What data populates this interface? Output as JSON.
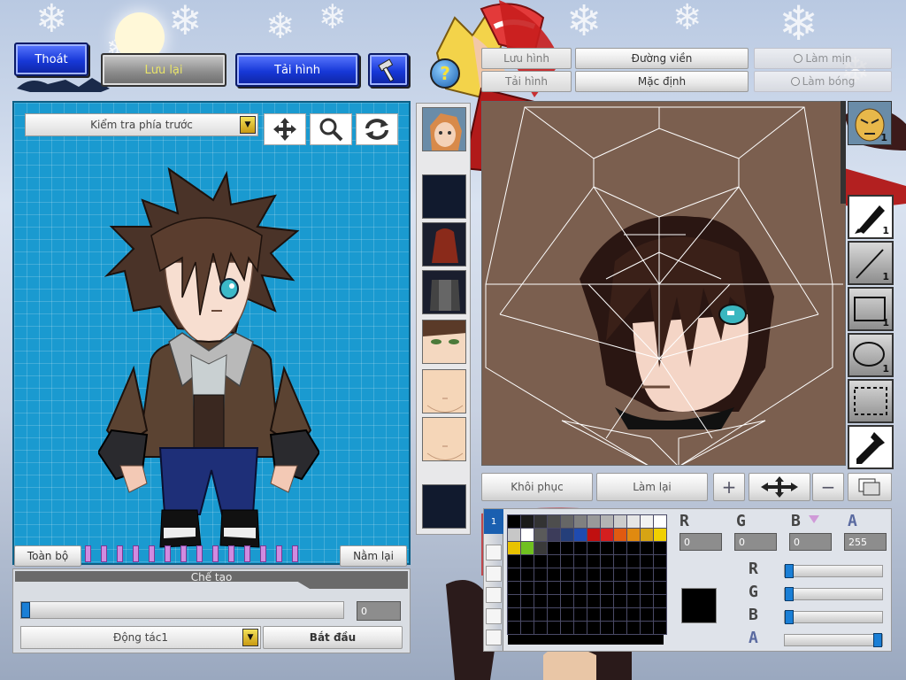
{
  "top_buttons": {
    "exit": "Thoát",
    "save": "Lưu lại",
    "reload": "Tải hình"
  },
  "top_right_buttons": {
    "save_image": "Lưu hình",
    "load_image": "Tải hình",
    "outline": "Đường viền",
    "default": "Mặc định",
    "smooth": "Làm mịn",
    "shade": "Làm bóng"
  },
  "preview": {
    "view_select": "Kiểm tra phía trước",
    "all": "Toàn bộ",
    "lie_down": "Nằm lại"
  },
  "create_panel": {
    "title": "Chế tạo",
    "frame_value": "0",
    "action_select": "Động tác1",
    "start": "Bắt đầu"
  },
  "editor_buttons": {
    "restore": "Khôi phục",
    "redo": "Làm lại"
  },
  "right_tools": [
    {
      "name": "pen-tool",
      "count": "1"
    },
    {
      "name": "line-tool",
      "count": "1"
    },
    {
      "name": "rectangle-tool",
      "count": "1"
    },
    {
      "name": "ellipse-tool",
      "count": "1"
    },
    {
      "name": "select-tool",
      "count": ""
    },
    {
      "name": "eyedropper-tool",
      "count": ""
    }
  ],
  "face_badge_count": "1",
  "color": {
    "r_label": "R",
    "g_label": "G",
    "b_label": "B",
    "a_label": "A",
    "r": "0",
    "g": "0",
    "b": "0",
    "a": "255",
    "current": "#000000",
    "sliders": {
      "r": 0,
      "g": 0,
      "b": 0,
      "a": 1
    }
  },
  "palette_top_row": [
    "#000000",
    "#1a1a1a",
    "#333333",
    "#4d4d4d",
    "#666666",
    "#808080",
    "#999999",
    "#b3b3b3",
    "#cccccc",
    "#e6e6e6",
    "#f2f2f2",
    "#ffffff"
  ],
  "palette_second_row": [
    "#c7c7c7",
    "#ffffff",
    "#5a5a5a",
    "#3c3c5a",
    "#253f7a",
    "#1f4bb0",
    "#c01010",
    "#d41f1f",
    "#e05a10",
    "#e08a10",
    "#d6a414",
    "#f0d000"
  ],
  "palette_third_row": [
    "#e8c200",
    "#70c020",
    "#3a3a3a"
  ]
}
